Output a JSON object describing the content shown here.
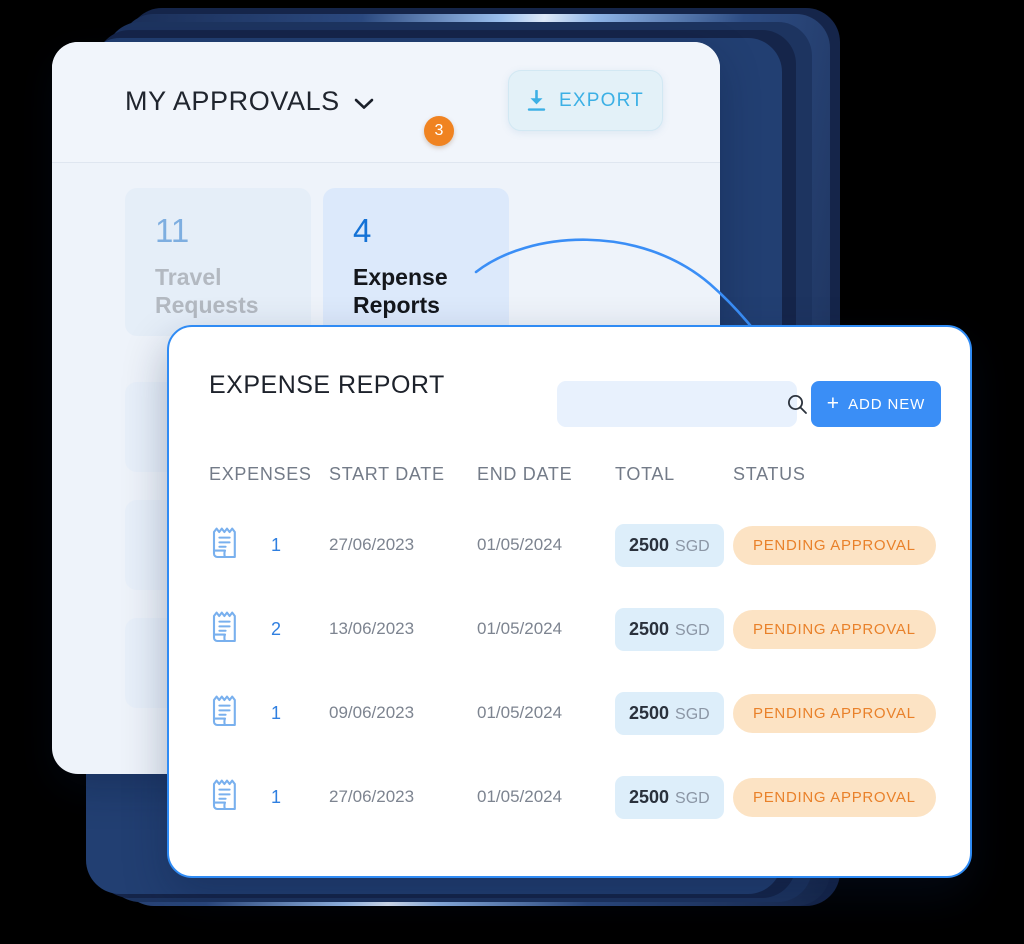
{
  "theme": {
    "accent_blue": "#3a8ef6",
    "deep_navy": "#223f72",
    "badge_orange": "#f08321",
    "status_orange": "#e9812a",
    "status_bg": "#fce3c4",
    "total_bg": "#ddeefa",
    "export_bg": "#e3f1f8",
    "export_text": "#3cb0e5"
  },
  "approvals_card": {
    "title": "MY APPROVALS",
    "chevron_icon": "chevron-down-icon",
    "badge_count": "3",
    "export_button": {
      "label": "EXPORT",
      "icon": "download-icon"
    },
    "stats": [
      {
        "value": "11",
        "label": "Travel\nRequests",
        "label_line1": "Travel",
        "label_line2": "Requests",
        "active": false
      },
      {
        "value": "4",
        "label": "Expense\nReports",
        "label_line1": "Expense",
        "label_line2": "Reports",
        "active": true
      }
    ]
  },
  "expense_card": {
    "title": "EXPENSE REPORT",
    "search": {
      "value": "",
      "placeholder": "",
      "icon": "search-icon"
    },
    "add_new_button": {
      "plus": "+",
      "label": "ADD NEW",
      "icon": "plus-icon"
    },
    "columns": [
      "EXPENSES",
      "START DATE",
      "END DATE",
      "TOTAL",
      "STATUS"
    ],
    "rows": [
      {
        "icon": "receipt-icon",
        "count": "1",
        "start_date": "27/06/2023",
        "end_date": "01/05/2024",
        "total_amount": "2500",
        "total_currency": "SGD",
        "status": "PENDING APPROVAL"
      },
      {
        "icon": "receipt-icon",
        "count": "2",
        "start_date": "13/06/2023",
        "end_date": "01/05/2024",
        "total_amount": "2500",
        "total_currency": "SGD",
        "status": "PENDING APPROVAL"
      },
      {
        "icon": "receipt-icon",
        "count": "1",
        "start_date": "09/06/2023",
        "end_date": "01/05/2024",
        "total_amount": "2500",
        "total_currency": "SGD",
        "status": "PENDING APPROVAL"
      },
      {
        "icon": "receipt-icon",
        "count": "1",
        "start_date": "27/06/2023",
        "end_date": "01/05/2024",
        "total_amount": "2500",
        "total_currency": "SGD",
        "status": "PENDING APPROVAL"
      }
    ]
  },
  "annotation": {
    "arrow_icon": "curved-arrow-icon",
    "description": "arrow from Expense Reports stat card to Expense Report panel"
  }
}
